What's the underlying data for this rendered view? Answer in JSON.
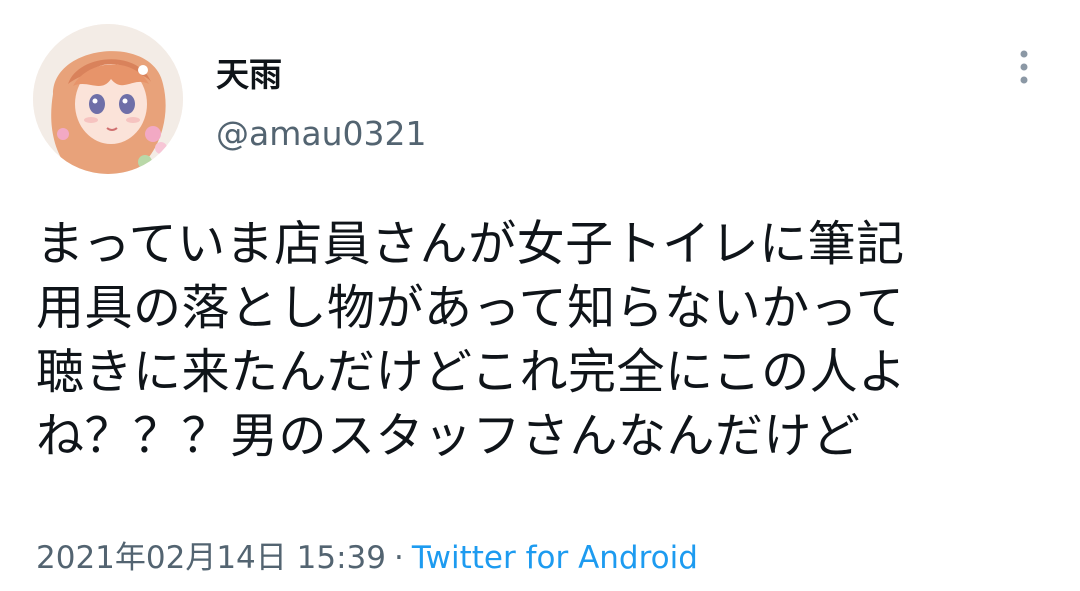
{
  "author": {
    "display_name": "天雨",
    "handle": "@amau0321"
  },
  "tweet": {
    "text": "まっていま店員さんが女子トイレに筆記\n用具の落とし物があって知らないかって\n聴きに来たんだけどこれ完全にこの人よ\nね？？？男のスタッフさんなんだけど"
  },
  "meta": {
    "timestamp": "2021年02月14日 15:39",
    "separator": "·",
    "source": "Twitter for Android"
  },
  "icons": {
    "more": "more-vertical-icon"
  },
  "colors": {
    "link": "#1d9bf0",
    "secondary_text": "#536471",
    "primary_text": "#0f1419"
  }
}
